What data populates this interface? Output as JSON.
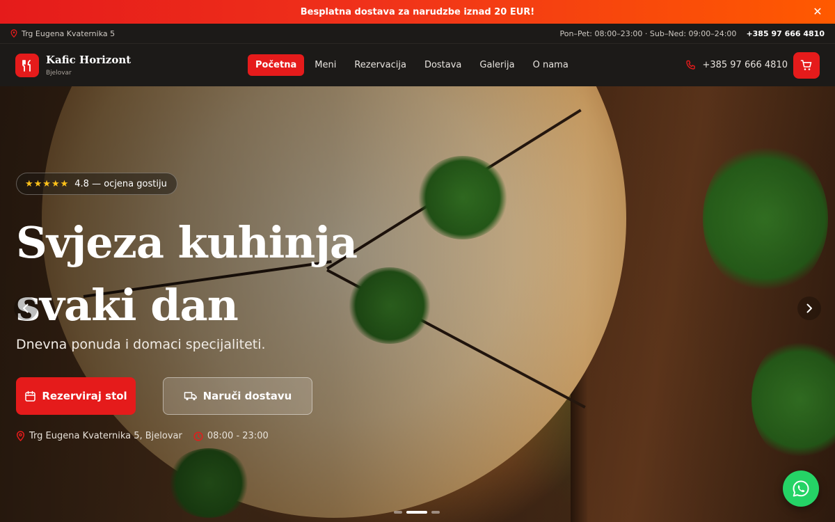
{
  "promo": {
    "text": "Besplatna dostava za narudzbe iznad 20 EUR!",
    "close_icon": "close-icon"
  },
  "infobar": {
    "address": "Trg Eugena Kvaternika 5",
    "hours": "Pon–Pet: 08:00–23:00 · Sub–Ned: 09:00–24:00",
    "phone": "+385 97 666 4810"
  },
  "header": {
    "brand_name": "Kafic Horizont",
    "brand_city": "Bjelovar",
    "nav": [
      "Početna",
      "Meni",
      "Rezervacija",
      "Dostava",
      "Galerija",
      "O nama"
    ],
    "active_nav": "Početna",
    "phone": "+385 97 666 4810"
  },
  "hero": {
    "rating_stars": "★★★★★",
    "rating_text": "4.8 — ocjena gostiju",
    "title_line1": "Svjeza kuhinja",
    "title_line2": "svaki dan",
    "subtitle": "Dnevna ponuda i domaci specijaliteti.",
    "reserve_label": "Rezerviraj stol",
    "delivery_label": "Naruči dostavu",
    "address": "Trg Eugena Kvaternika 5, Bjelovar",
    "hours": "08:00 - 23:00",
    "slides_count": 3,
    "active_slide": 2
  },
  "colors": {
    "accent": "#e51b1b",
    "promo_end": "#ff5a00",
    "whatsapp": "#25d366",
    "star": "#ffc21a"
  }
}
